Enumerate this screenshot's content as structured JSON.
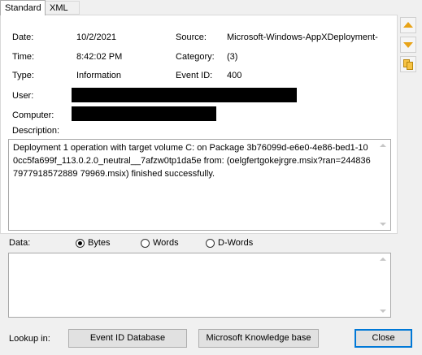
{
  "tabs": [
    {
      "label": "Standard"
    },
    {
      "label": "XML"
    }
  ],
  "fields": {
    "date_label": "Date:",
    "date_value": "10/2/2021",
    "time_label": "Time:",
    "time_value": "8:42:02 PM",
    "type_label": "Type:",
    "type_value": "Information",
    "user_label": "User:",
    "computer_label": "Computer:",
    "source_label": "Source:",
    "source_value": "Microsoft-Windows-AppXDeployment-",
    "category_label": "Category:",
    "category_value": "(3)",
    "event_id_label": "Event ID:",
    "event_id_value": "400"
  },
  "description": {
    "label": "Description:",
    "text": "Deployment 1 operation with target volume C: on Package 3b76099d-e6e0-4e86-bed1-100cc5fa699f_113.0.2.0_neutral__7afzw0tp1da5e from:  (oelgfertgokejrgre.msix?ran=2448367977918572889 79969.msix)  finished successfully."
  },
  "data": {
    "label": "Data:",
    "options": [
      {
        "label": "Bytes",
        "checked": true
      },
      {
        "label": "Words",
        "checked": false
      },
      {
        "label": "D-Words",
        "checked": false
      }
    ]
  },
  "footer": {
    "lookup_label": "Lookup in:",
    "event_id_db_button": "Event ID Database",
    "kb_button": "Microsoft Knowledge base",
    "close_button": "Close"
  },
  "side_icons": [
    "previous-event-icon",
    "next-event-icon",
    "copy-icon"
  ],
  "colors": {
    "arrow_accent": "#e8a317",
    "redaction": "#000000",
    "close_button_border": "#0078d7"
  }
}
